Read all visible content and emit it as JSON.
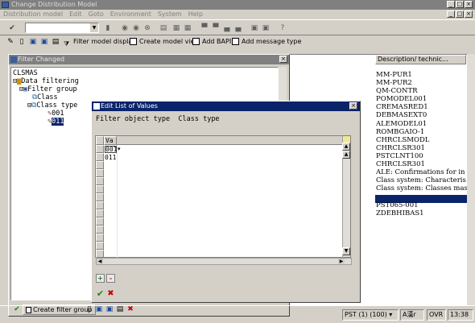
{
  "window": {
    "title": "Change Distribution Model"
  },
  "menu": [
    "Distribution model",
    "Edit",
    "Goto",
    "Environment",
    "System",
    "Help"
  ],
  "toolbar": {
    "buttons": [
      {
        "label": "Filter model display"
      },
      {
        "label": "Create model view"
      },
      {
        "label": "Add BAPI"
      },
      {
        "label": "Add message type"
      }
    ]
  },
  "left_pane": {
    "title": "Filter Changed",
    "root": "CLSMAS",
    "tree": [
      "Data filtering",
      "Filter group",
      "Class",
      "Class type",
      "001",
      "011"
    ]
  },
  "right_pane": {
    "header": "Description/ technic...",
    "items": [
      "MM-PUR1",
      "MM-PUR2",
      "QM-CONTR",
      "POMODEL001",
      "CREMASRED1",
      "DEBMASEXT0",
      "ALEMODEL01",
      "ROMBGAIO-1",
      "CHRCLSMODL",
      "CHRCLSR301",
      "PSTCLNT100",
      "CHRCLSR301",
      "ALE: Confirmations for in",
      "Class system: Characteris",
      "Class system: Classes mas",
      "",
      "PST065-001",
      "ZDEBHIBAS1"
    ]
  },
  "dialog": {
    "title": "Edit List of Values",
    "filter_label": "Filter object type",
    "filter_value": "Class type",
    "column_header": "Va",
    "values": [
      "001",
      "011"
    ]
  },
  "bottom_toolbar": {
    "create_filter_group": "Create filter group"
  },
  "status": {
    "system": "PST (1) (100)",
    "mode": "OVR",
    "time": "13:38"
  }
}
